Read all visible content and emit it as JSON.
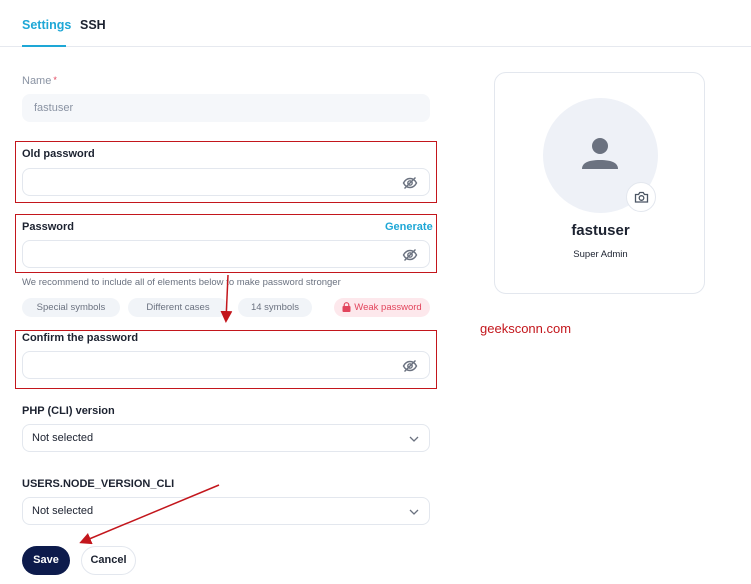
{
  "tabs": [
    {
      "label": "Settings",
      "active": true
    },
    {
      "label": "SSH",
      "active": false
    }
  ],
  "name_field": {
    "label": "Name",
    "required_mark": "*",
    "value": "fastuser"
  },
  "old_password": {
    "label": "Old password",
    "value": ""
  },
  "password": {
    "label": "Password",
    "generate_label": "Generate",
    "value": ""
  },
  "password_hint": "We recommend to include all of elements below to make password stronger",
  "requirements": [
    {
      "label": "Special symbols"
    },
    {
      "label": "Different cases"
    },
    {
      "label": "14 symbols"
    }
  ],
  "strength": {
    "label": "Weak password",
    "color": "#e2445c"
  },
  "confirm_password": {
    "label": "Confirm the password",
    "value": ""
  },
  "php_version": {
    "label": "PHP (CLI) version",
    "selected": "Not selected"
  },
  "node_version": {
    "label": "USERS.NODE_VERSION_CLI",
    "selected": "Not selected"
  },
  "actions": {
    "save_label": "Save",
    "cancel_label": "Cancel"
  },
  "profile": {
    "name": "fastuser",
    "role": "Super Admin",
    "avatar_icon": "user-icon",
    "camera_icon": "camera-icon"
  },
  "watermark": "geeksconn.com",
  "colors": {
    "accent": "#1ea7d6",
    "primary_button": "#0d1b4c",
    "annotation": "#c3161c",
    "danger": "#e2445c"
  }
}
